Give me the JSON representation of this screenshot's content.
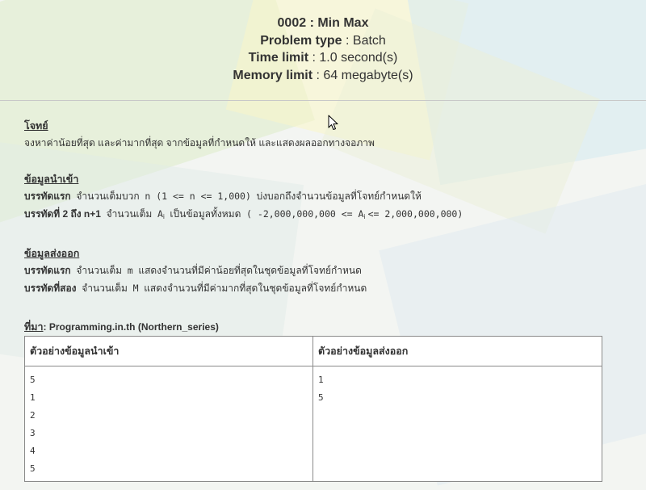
{
  "problem": {
    "title": "0002 : Min Max",
    "type_label": "Problem type",
    "type_value": "Batch",
    "time_label": "Time limit",
    "time_value": "1.0 second(s)",
    "memory_label": "Memory limit",
    "memory_value": "64 megabyte(s)"
  },
  "statement": {
    "heading": "โจทย์",
    "text": "จงหาค่าน้อยที่สุด และค่ามากที่สุด จากข้อมูลที่กำหนดให้ และแสดงผลออกทางจอภาพ"
  },
  "input_spec": {
    "heading": "ข้อมูลนำเข้า",
    "line1_label": "บรรทัดแรก",
    "line1_pre": "จำนวนเต็มบวก",
    "line1_code": "n (1 <= n <= 1,000)",
    "line1_post": "บ่งบอกถึงจำนวนข้อมูลที่โจทย์กำหนดให้",
    "line2_label": "บรรทัดที่ 2 ถึง n+1",
    "line2_pre": "จำนวนเต็ม",
    "line2_var": "A",
    "line2_sub": "i",
    "line2_mid": "เป็นข้อมูลทั้งหมด",
    "line2_code_a": "( -2,000,000,000 <= A",
    "line2_code_sub": "i",
    "line2_code_b": "<= 2,000,000,000)"
  },
  "output_spec": {
    "heading": "ข้อมูลส่งออก",
    "line1_label": "บรรทัดแรก",
    "line1_pre": "จำนวนเต็ม",
    "line1_code": "m",
    "line1_post": "แสดงจำนวนที่มีค่าน้อยที่สุดในชุดข้อมูลที่โจทย์กำหนด",
    "line2_label": "บรรทัดที่สอง",
    "line2_pre": "จำนวนเต็ม",
    "line2_code": "M",
    "line2_post": "แสดงจำนวนที่มีค่ามากที่สุดในชุดข้อมูลที่โจทย์กำหนด"
  },
  "source": {
    "label": "ที่มา",
    "value": ": Programming.in.th (Northern_series)"
  },
  "examples": {
    "input_header": "ตัวอย่างข้อมูลนำเข้า",
    "output_header": "ตัวอย่างข้อมูลส่งออก",
    "input_lines": [
      "5",
      "1",
      "2",
      "3",
      "4",
      "5"
    ],
    "output_lines": [
      "1",
      "5"
    ]
  },
  "colors": {
    "text": "#333333",
    "background": "#f3f5f2"
  }
}
